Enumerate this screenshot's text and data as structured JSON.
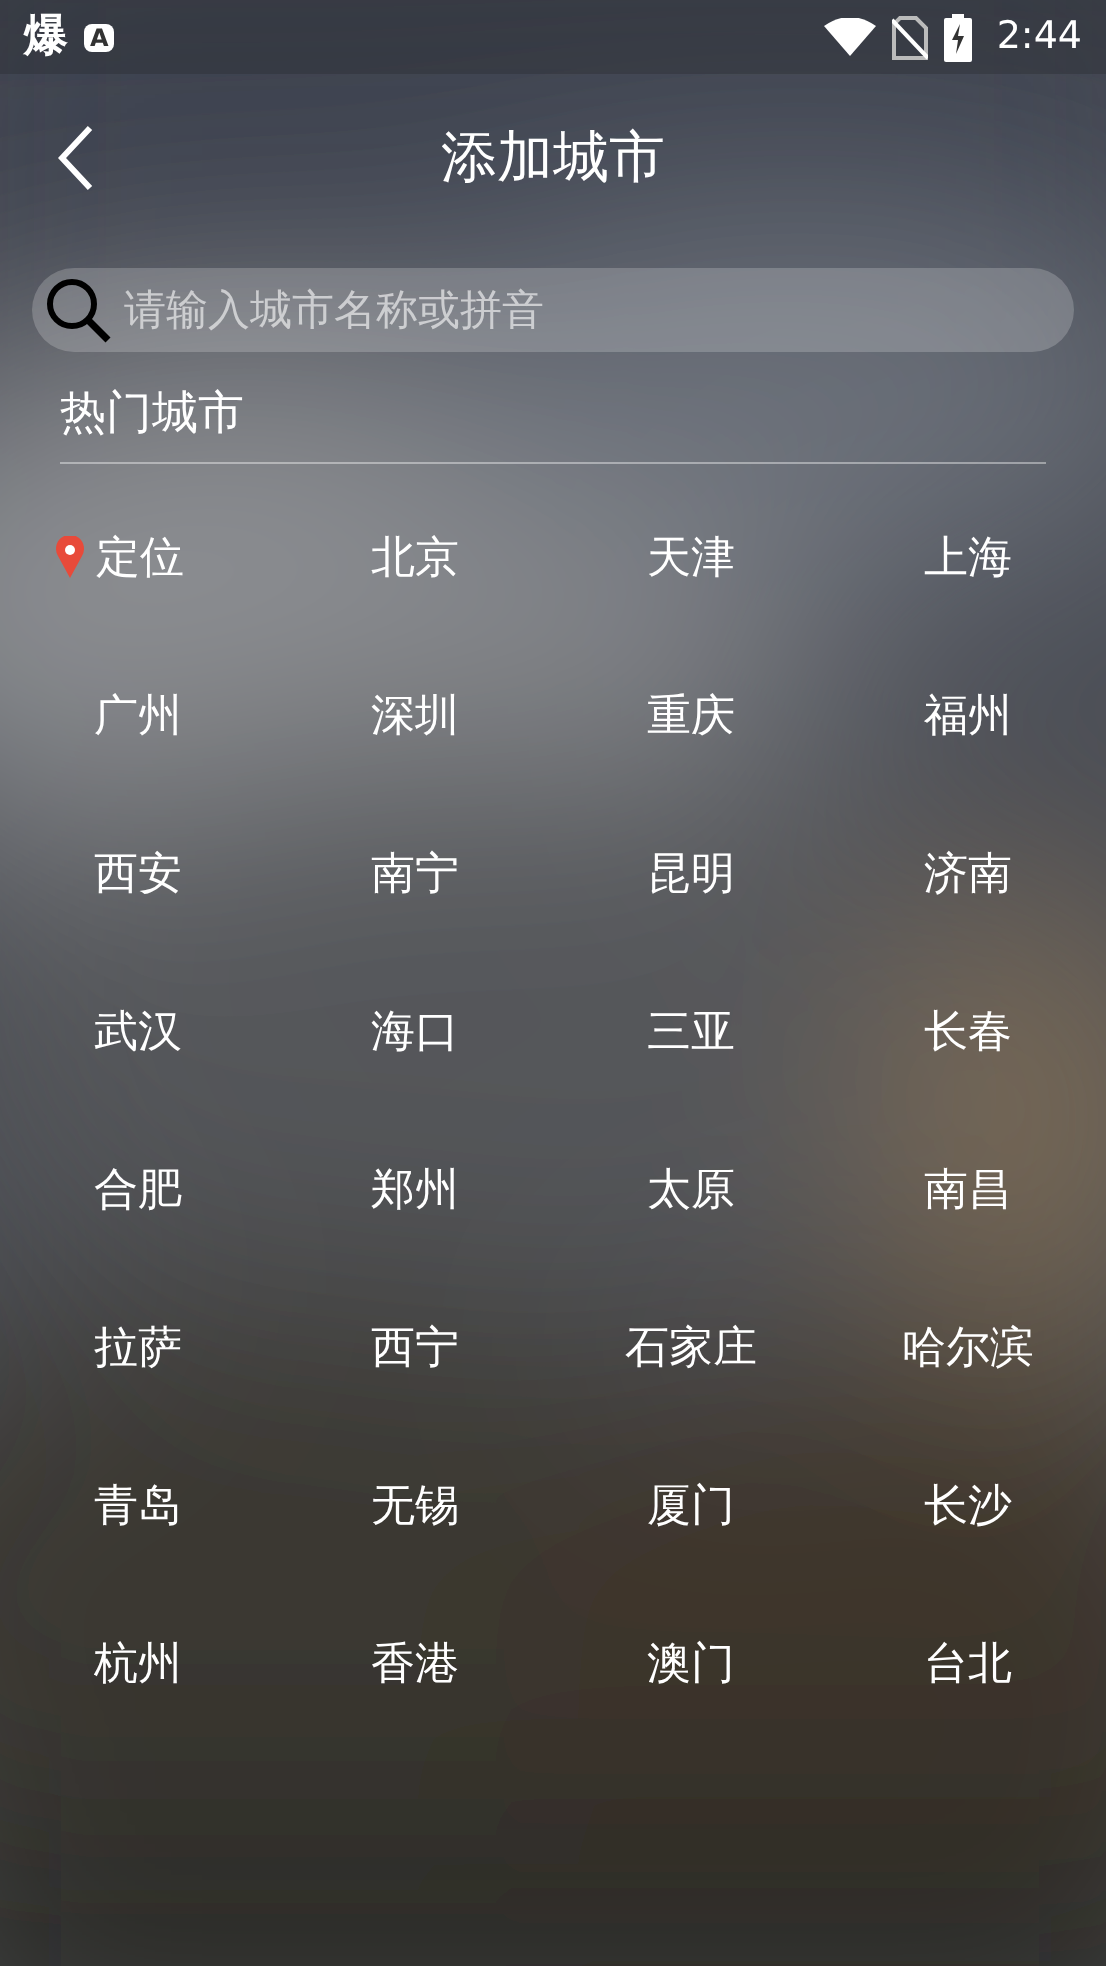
{
  "status_bar": {
    "notifications": [
      "爆",
      "A"
    ],
    "time": "2:44"
  },
  "header": {
    "title": "添加城市"
  },
  "search": {
    "placeholder": "请输入城市名称或拼音"
  },
  "hot_cities": {
    "title": "热门城市",
    "items": [
      {
        "label": "定位",
        "kind": "location"
      },
      {
        "label": "北京",
        "kind": "city"
      },
      {
        "label": "天津",
        "kind": "city"
      },
      {
        "label": "上海",
        "kind": "city"
      },
      {
        "label": "广州",
        "kind": "city"
      },
      {
        "label": "深圳",
        "kind": "city"
      },
      {
        "label": "重庆",
        "kind": "city"
      },
      {
        "label": "福州",
        "kind": "city"
      },
      {
        "label": "西安",
        "kind": "city"
      },
      {
        "label": "南宁",
        "kind": "city"
      },
      {
        "label": "昆明",
        "kind": "city"
      },
      {
        "label": "济南",
        "kind": "city"
      },
      {
        "label": "武汉",
        "kind": "city"
      },
      {
        "label": "海口",
        "kind": "city"
      },
      {
        "label": "三亚",
        "kind": "city"
      },
      {
        "label": "长春",
        "kind": "city"
      },
      {
        "label": "合肥",
        "kind": "city"
      },
      {
        "label": "郑州",
        "kind": "city"
      },
      {
        "label": "太原",
        "kind": "city"
      },
      {
        "label": "南昌",
        "kind": "city"
      },
      {
        "label": "拉萨",
        "kind": "city"
      },
      {
        "label": "西宁",
        "kind": "city"
      },
      {
        "label": "石家庄",
        "kind": "city"
      },
      {
        "label": "哈尔滨",
        "kind": "city"
      },
      {
        "label": "青岛",
        "kind": "city"
      },
      {
        "label": "无锡",
        "kind": "city"
      },
      {
        "label": "厦门",
        "kind": "city"
      },
      {
        "label": "长沙",
        "kind": "city"
      },
      {
        "label": "杭州",
        "kind": "city"
      },
      {
        "label": "香港",
        "kind": "city"
      },
      {
        "label": "澳门",
        "kind": "city"
      },
      {
        "label": "台北",
        "kind": "city"
      }
    ]
  }
}
